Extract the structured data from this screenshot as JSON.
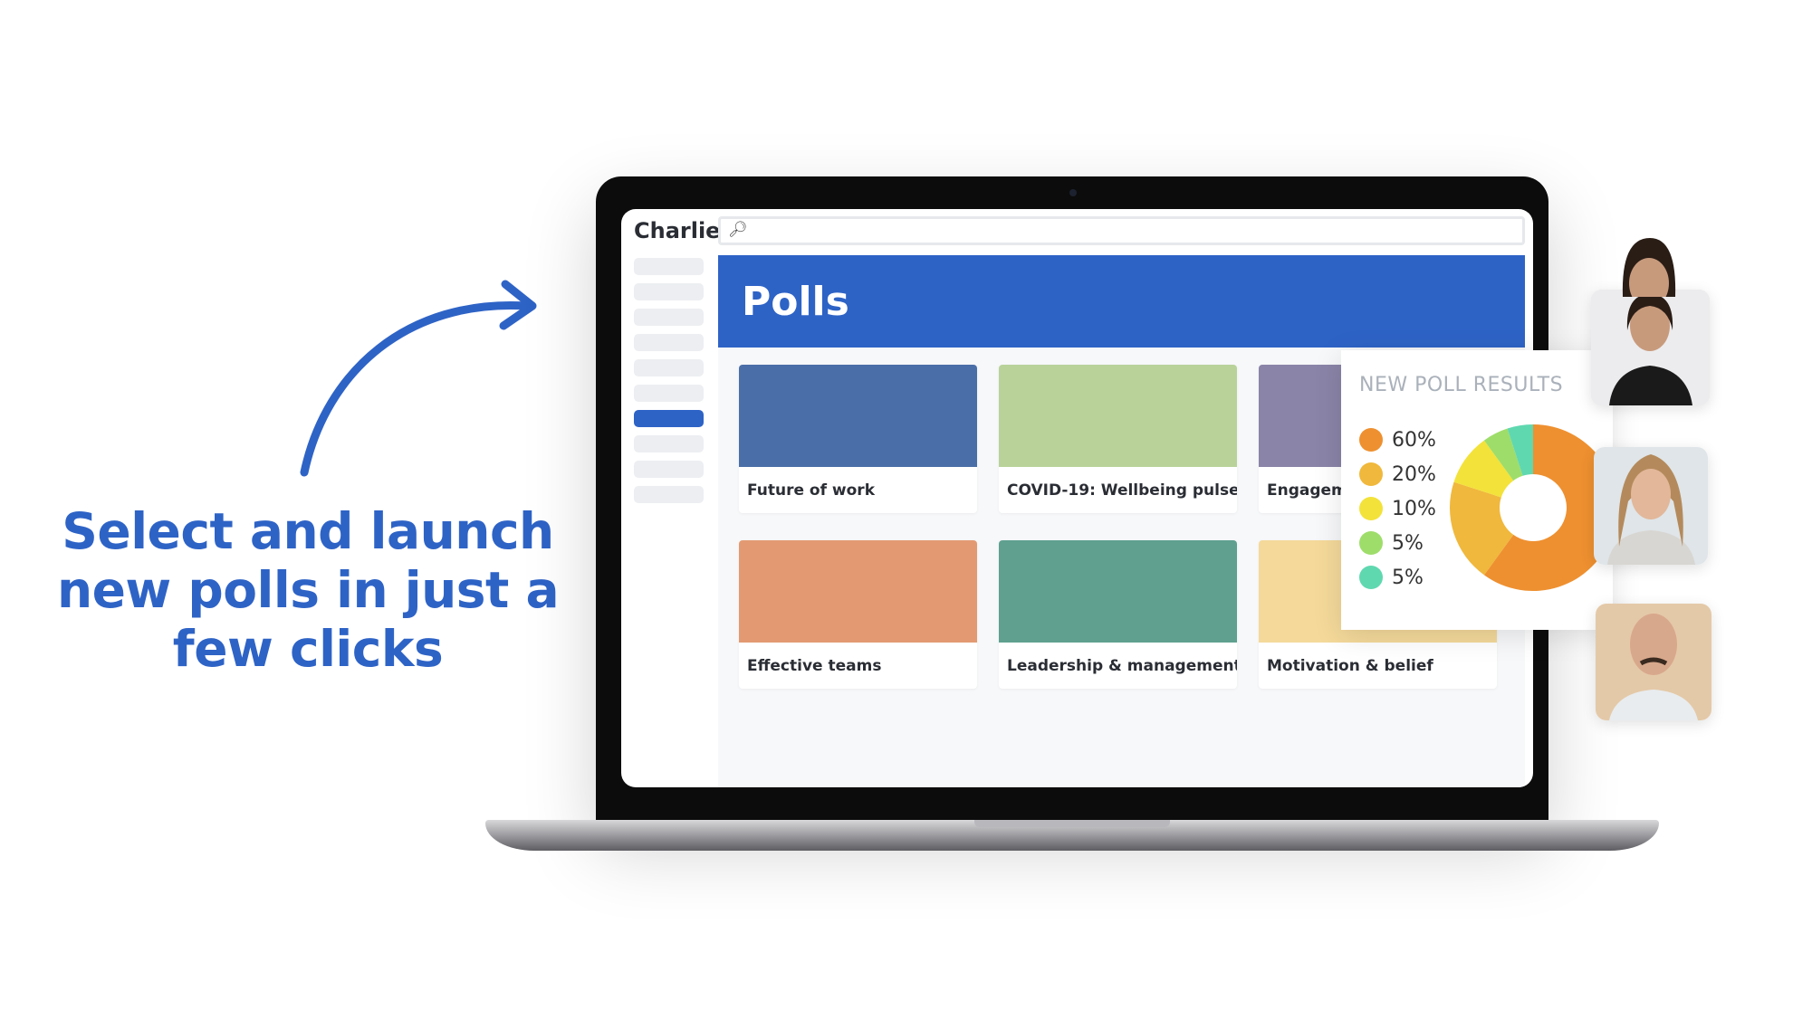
{
  "tagline": [
    "Select and launch",
    "new polls in just a",
    "few clicks"
  ],
  "app": {
    "brand": "Charlie",
    "search_icon": "magnifier-icon",
    "sidebar_active_index": 6,
    "hero_title": "Polls",
    "cards": [
      {
        "label": "Future of work",
        "bg": "#4a6fa8"
      },
      {
        "label": "COVID-19: Wellbeing pulse",
        "bg": "#b9d29a"
      },
      {
        "label": "Engagement",
        "bg": "#8a84a8"
      },
      {
        "label": "Effective teams",
        "bg": "#e39a72"
      },
      {
        "label": "Leadership & management",
        "bg": "#5fa08f"
      },
      {
        "label": "Motivation & belief",
        "bg": "#f4d99a"
      }
    ]
  },
  "poll_results": {
    "title": "NEW POLL RESULTS",
    "items": [
      {
        "label": "60%",
        "value": 60,
        "color": "#ee9030"
      },
      {
        "label": "20%",
        "value": 20,
        "color": "#f0b83c"
      },
      {
        "label": "10%",
        "value": 10,
        "color": "#f3e23a"
      },
      {
        "label": "5%",
        "value": 5,
        "color": "#9edd6a"
      },
      {
        "label": "5%",
        "value": 5,
        "color": "#5fd8b0"
      }
    ]
  },
  "colors": {
    "brand_blue": "#2e63c6"
  }
}
